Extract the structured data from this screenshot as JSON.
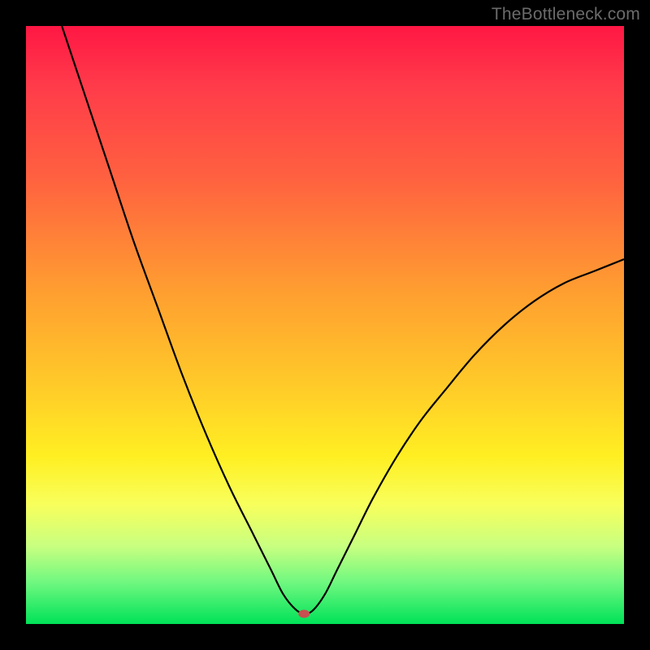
{
  "watermark": "TheBottleneck.com",
  "chart_data": {
    "type": "line",
    "title": "",
    "xlabel": "",
    "ylabel": "",
    "xlim": [
      0,
      100
    ],
    "ylim": [
      0,
      100
    ],
    "grid": false,
    "legend": false,
    "gradient_stops": [
      {
        "pct": 0,
        "color": "#ff1744"
      },
      {
        "pct": 10,
        "color": "#ff3b4a"
      },
      {
        "pct": 25,
        "color": "#ff6040"
      },
      {
        "pct": 45,
        "color": "#ffa030"
      },
      {
        "pct": 62,
        "color": "#ffd028"
      },
      {
        "pct": 72,
        "color": "#ffef22"
      },
      {
        "pct": 80,
        "color": "#f8ff5c"
      },
      {
        "pct": 87,
        "color": "#c8ff80"
      },
      {
        "pct": 93,
        "color": "#70f880"
      },
      {
        "pct": 100,
        "color": "#00e258"
      }
    ],
    "curve_points": [
      {
        "x": 6,
        "y": 100
      },
      {
        "x": 10,
        "y": 88
      },
      {
        "x": 14,
        "y": 76
      },
      {
        "x": 18,
        "y": 64
      },
      {
        "x": 22,
        "y": 53
      },
      {
        "x": 26,
        "y": 42
      },
      {
        "x": 30,
        "y": 32
      },
      {
        "x": 34,
        "y": 23
      },
      {
        "x": 38,
        "y": 15
      },
      {
        "x": 41,
        "y": 9
      },
      {
        "x": 43,
        "y": 5
      },
      {
        "x": 45,
        "y": 2.5
      },
      {
        "x": 46.5,
        "y": 1.7
      },
      {
        "x": 48,
        "y": 2.3
      },
      {
        "x": 50,
        "y": 5
      },
      {
        "x": 52,
        "y": 9
      },
      {
        "x": 55,
        "y": 15
      },
      {
        "x": 58,
        "y": 21
      },
      {
        "x": 62,
        "y": 28
      },
      {
        "x": 66,
        "y": 34
      },
      {
        "x": 70,
        "y": 39
      },
      {
        "x": 75,
        "y": 45
      },
      {
        "x": 80,
        "y": 50
      },
      {
        "x": 85,
        "y": 54
      },
      {
        "x": 90,
        "y": 57
      },
      {
        "x": 95,
        "y": 59
      },
      {
        "x": 100,
        "y": 61
      }
    ],
    "marker": {
      "x": 46.5,
      "y": 1.7,
      "color": "#c85050"
    },
    "curve_color": "#000000",
    "curve_width": 2.2
  }
}
